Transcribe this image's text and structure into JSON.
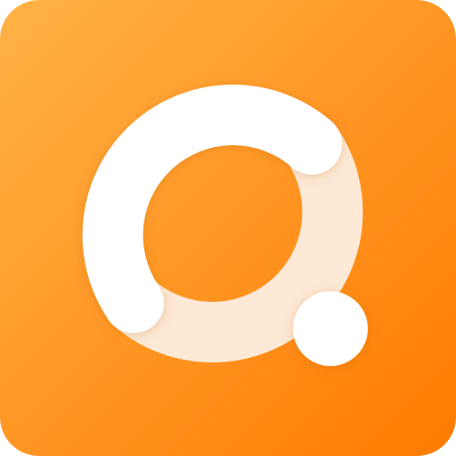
{
  "icon": {
    "name": "orange-circle-logo-app-icon",
    "description_label": "",
    "colors": {
      "gradient_start": "#FFB347",
      "gradient_end": "#FF7A00",
      "ring_white": "#FFFFFF",
      "ring_tint": "#FDE9D6",
      "dot_white": "#FFFFFF"
    }
  }
}
